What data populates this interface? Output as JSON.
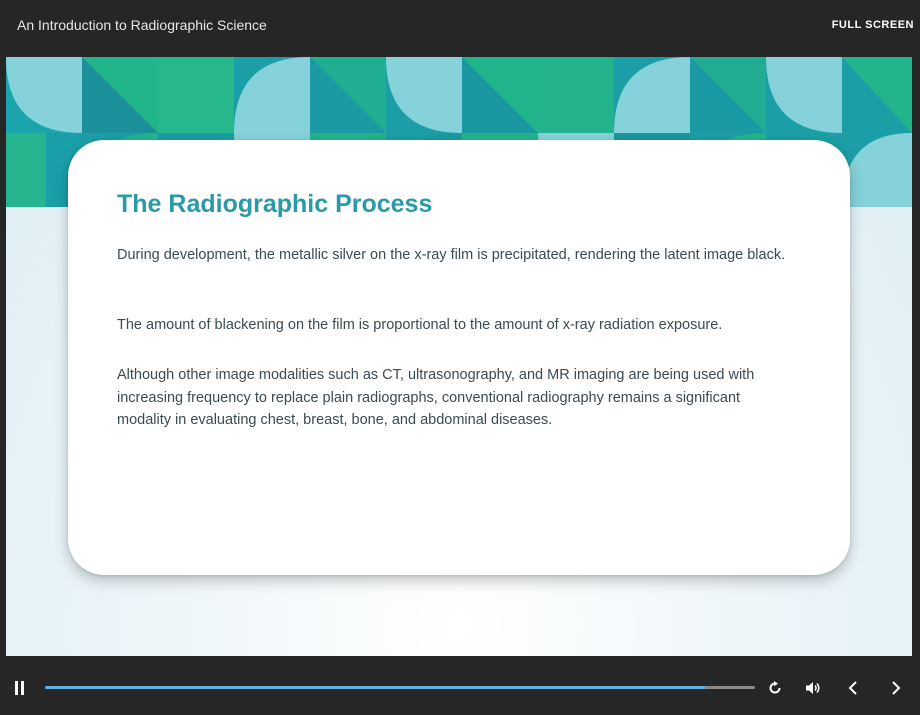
{
  "header": {
    "title": "An Introduction to Radiographic Science",
    "fullscreen_label": "FULL SCREEN"
  },
  "slide": {
    "heading": "The Radiographic Process",
    "paragraphs": [
      "During development, the metallic silver on the x-ray film is precipitated, rendering the latent image black.",
      "The amount of blackening on the film is proportional to the amount of x-ray radiation exposure.",
      "Although other image modalities such as CT, ultrasonography, and MR imaging are being used with increasing frequency to replace plain radiographs, conventional radiography remains a significant modality in evaluating chest, breast, bone, and abdominal diseases."
    ]
  },
  "player": {
    "progress": 0.93
  },
  "icons": [
    "pause-icon",
    "replay-icon",
    "volume-icon",
    "prev-icon",
    "next-icon"
  ],
  "colors": {
    "accent": "#2a9aa8",
    "teal": "#1c9ea6",
    "green": "#22b58b",
    "light_teal": "#86d2da",
    "progress": "#5bb3e8"
  }
}
